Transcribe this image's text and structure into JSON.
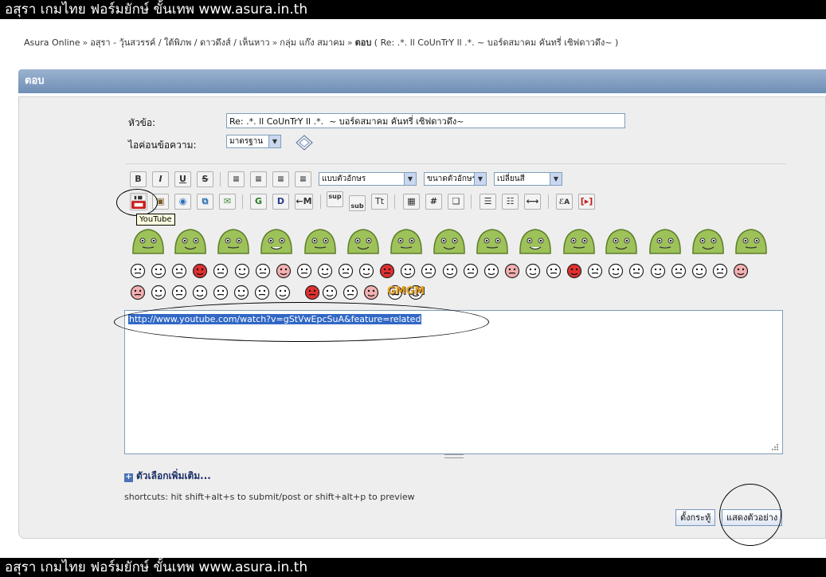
{
  "banner": "อสุรา เกมไทย ฟอร์มยักษ์ ขั้นเทพ www.asura.in.th",
  "breadcrumb": {
    "items": [
      "Asura Online",
      "อสุรา - วุ้นสวรรค์ / ใต้พิภพ / ดาวดึงส์ / เห็นหาว",
      "กลุ่ม แก๊ง สมาคม"
    ],
    "current_prefix": "ตอบ",
    "current_rest": "( Re: .*. ll CoUnTrY ll .*.  ~ บอร์ดสมาคม คันทรี่ เซิฟดาวดึง~ )"
  },
  "section_title": "ตอบ",
  "form": {
    "subject_label": "หัวข้อ:",
    "subject_value": "Re: .*. ll CoUnTrY ll .*.  ~ บอร์ดสมาคม คันทรี่ เซิฟดาวดึง~",
    "icon_label": "ไอค่อนข้อความ:",
    "icon_value": "มาตรฐาน"
  },
  "toolbar": {
    "font_face": "แบบตัวอักษร",
    "font_size": "ขนาดตัวอักษร",
    "font_color": "เปลี่ยนสี",
    "tooltip": "YouTube"
  },
  "editor": {
    "content": "http://www.youtube.com/watch?v=gStVwEpcSuA&feature=related"
  },
  "more_options": "ตัวเลือกเพิ่มเติม...",
  "shortcuts": "shortcuts: hit shift+alt+s to submit/post or shift+alt+p to preview",
  "buttons": {
    "post": "ตั้งกระทู้",
    "preview": "แสดงตัวอย่าง"
  },
  "colors": {
    "header": "#7f9dc0",
    "selection": "#3168c5",
    "youtube_red": "#cc1f1f",
    "blob_green": "#9ec25a"
  }
}
